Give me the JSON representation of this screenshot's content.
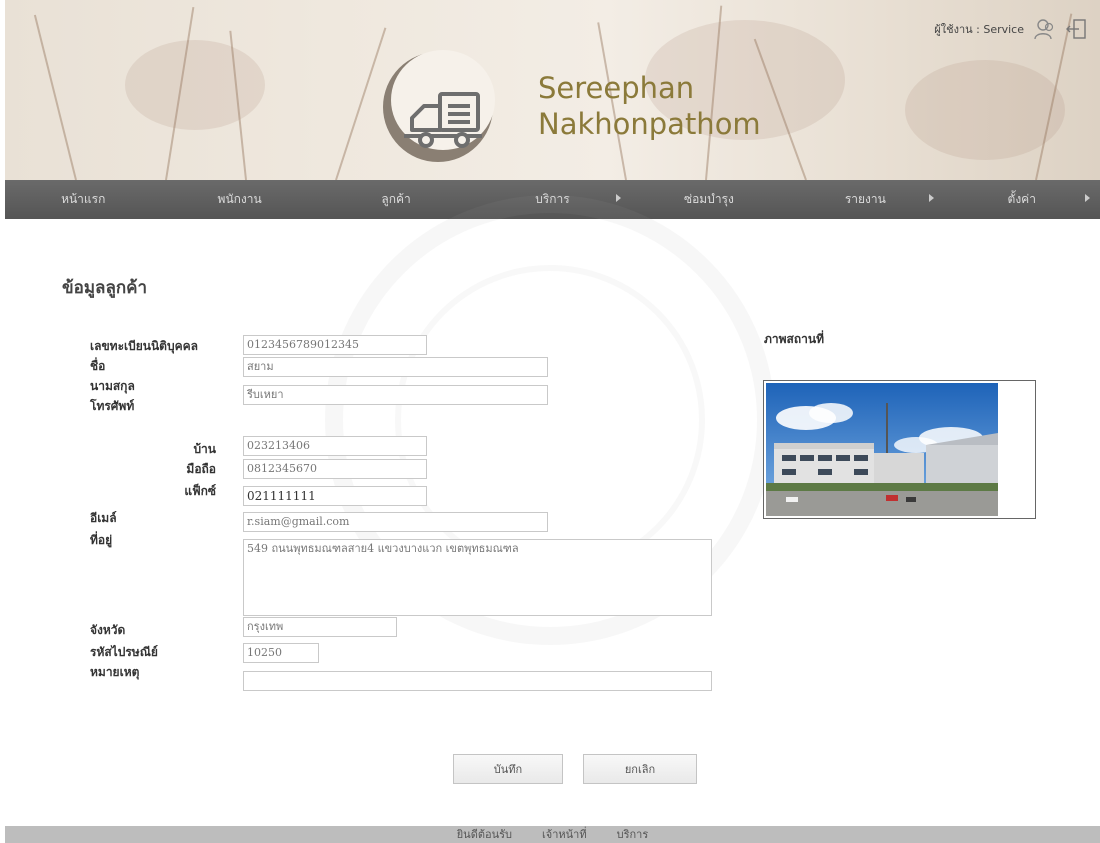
{
  "header": {
    "brand_line1": "Sereephan",
    "brand_line2": "Nakhonpathom",
    "user_greeting": "ผู้ใช้งาน : Service"
  },
  "nav": {
    "items": [
      {
        "label": "หน้าแรก",
        "has_submenu": false
      },
      {
        "label": "พนักงาน",
        "has_submenu": false
      },
      {
        "label": "ลูกค้า",
        "has_submenu": false
      },
      {
        "label": "บริการ",
        "has_submenu": true
      },
      {
        "label": "ซ่อมบำรุง",
        "has_submenu": false
      },
      {
        "label": "รายงาน",
        "has_submenu": true
      },
      {
        "label": "ตั้งค่า",
        "has_submenu": true
      }
    ]
  },
  "page": {
    "title": "ข้อมูลลูกค้า"
  },
  "form": {
    "tax_id_label": "เลขทะเบียนนิติบุคคล",
    "tax_id_value": "0123456789012345",
    "first_name_label": "ชื่อ",
    "first_name_value": "สยาม",
    "last_name_label": "นามสกุล",
    "last_name_value": "รีบเหยา",
    "phone_label": "โทรศัพท์",
    "home_label": "บ้าน",
    "home_value": "023213406",
    "mobile_label": "มือถือ",
    "mobile_value": "0812345670",
    "fax_label": "แฟ็กซ์",
    "fax_value": "021111111",
    "email_label": "อีเมล์",
    "email_value": "r.siam@gmail.com",
    "address_label": "ที่อยู่",
    "address_value": "549 ถนนพุทธมณฑลสาย4 แขวงบางแวก เขตพุทธมณฑล",
    "province_label": "จังหวัด",
    "province_value": "กรุงเทพ",
    "postcode_label": "รหัสไปรษณีย์",
    "postcode_value": "10250",
    "remark_label": "หมายเหตุ",
    "remark_value": ""
  },
  "location": {
    "label": "ภาพสถานที่"
  },
  "buttons": {
    "save": "บันทึก",
    "cancel": "ยกเลิก"
  },
  "footer": {
    "items": [
      "ยินดีต้อนรับ",
      "เจ้าหน้าที่",
      "บริการ"
    ]
  },
  "colors": {
    "navbar": "#5f5f5f",
    "brand": "#8b7a3a",
    "footer": "#bdbdbd"
  }
}
